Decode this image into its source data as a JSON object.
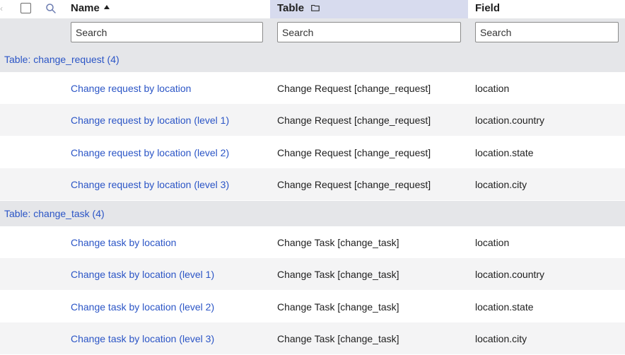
{
  "header": {
    "name_label": "Name",
    "table_label": "Table",
    "field_label": "Field"
  },
  "search": {
    "name_placeholder": "Search",
    "table_placeholder": "Search",
    "field_placeholder": "Search"
  },
  "colors": {
    "link": "#2b55c6",
    "group_bg": "#e5e6e9",
    "alt_row_bg": "#f4f4f5",
    "active_header_bg": "#d7dbee"
  },
  "groups": [
    {
      "label": "Table: change_request (4)",
      "rows": [
        {
          "name": "Change request by location",
          "table": "Change Request [change_request]",
          "field": "location"
        },
        {
          "name": "Change request by location (level 1)",
          "table": "Change Request [change_request]",
          "field": "location.country"
        },
        {
          "name": "Change request by location (level 2)",
          "table": "Change Request [change_request]",
          "field": "location.state"
        },
        {
          "name": "Change request by location (level 3)",
          "table": "Change Request [change_request]",
          "field": "location.city"
        }
      ]
    },
    {
      "label": "Table: change_task (4)",
      "rows": [
        {
          "name": "Change task by location",
          "table": "Change Task [change_task]",
          "field": "location"
        },
        {
          "name": "Change task by location (level 1)",
          "table": "Change Task [change_task]",
          "field": "location.country"
        },
        {
          "name": "Change task by location (level 2)",
          "table": "Change Task [change_task]",
          "field": "location.state"
        },
        {
          "name": "Change task by location (level 3)",
          "table": "Change Task [change_task]",
          "field": "location.city"
        }
      ]
    }
  ]
}
